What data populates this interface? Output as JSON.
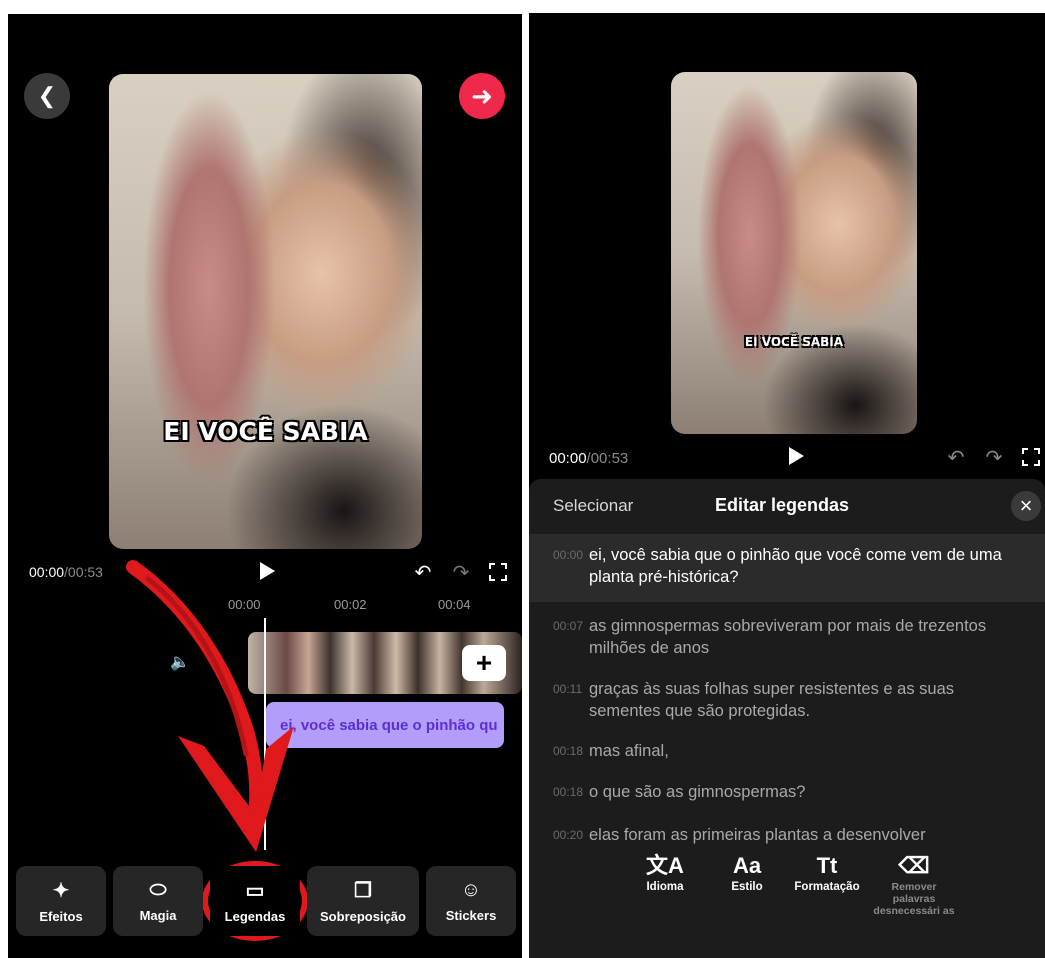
{
  "left": {
    "video_caption": "EI VOCÊ SABIA",
    "time_current": "00:00",
    "time_total": "/00:53",
    "ruler": [
      "00:00",
      "00:02",
      "00:04"
    ],
    "caption_clip": "ei, você sabia que o pinhão qu",
    "add_label": "+",
    "tools": [
      {
        "label": "Efeitos",
        "icon": "sparkles-icon",
        "glyph": "✦"
      },
      {
        "label": "Magia",
        "icon": "magic-icon",
        "glyph": "⬭"
      },
      {
        "label": "Legendas",
        "icon": "captions-icon",
        "glyph": "▭"
      },
      {
        "label": "Sobreposição",
        "icon": "overlay-icon",
        "glyph": "❐"
      },
      {
        "label": "Stickers",
        "icon": "sticker-icon",
        "glyph": "☺"
      }
    ],
    "accent_color": "#f0284a",
    "annotation_color": "#e0191c",
    "clip_color": "#b39dfa"
  },
  "right": {
    "video_caption": "EI VOCÊ SABIA",
    "time_current": "00:00",
    "time_total": "/00:53",
    "header": {
      "select": "Selecionar",
      "title": "Editar legendas",
      "close": "×"
    },
    "subtitles": [
      {
        "time": "00:00",
        "text": "ei, você sabia que o pinhão que você come vem de uma planta pré-histórica?"
      },
      {
        "time": "00:07",
        "text": "as gimnospermas sobreviveram por mais de trezentos milhões de anos"
      },
      {
        "time": "00:11",
        "text": "graças às suas folhas super resistentes e as suas sementes que são protegidas."
      },
      {
        "time": "00:18",
        "text": "mas afinal,"
      },
      {
        "time": "00:18",
        "text": "o que são as gimnospermas?"
      },
      {
        "time": "00:20",
        "text": "elas foram as primeiras plantas a desenvolver"
      }
    ],
    "formatting": [
      {
        "label": "Idioma",
        "glyph": "文A",
        "icon": "translate-icon"
      },
      {
        "label": "Estilo",
        "glyph": "Aa",
        "icon": "style-icon"
      },
      {
        "label": "Formatação",
        "glyph": "Tt",
        "icon": "format-icon"
      },
      {
        "label": "Remover palavras desnecessári as",
        "glyph": "⌫",
        "icon": "eraser-icon"
      }
    ]
  }
}
